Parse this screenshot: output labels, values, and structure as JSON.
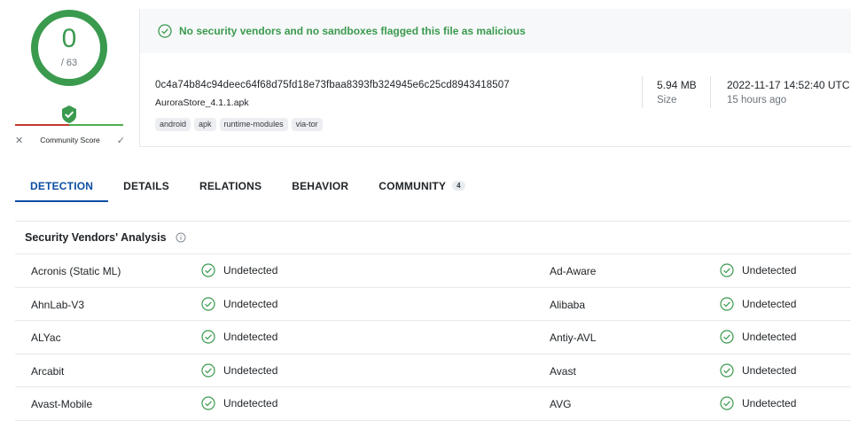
{
  "score": {
    "detections": "0",
    "total": "/ 63",
    "community_label": "Community Score",
    "ring_color": "#3a9a4e"
  },
  "summary": {
    "banner": "No security vendors and no sandboxes flagged this file as malicious",
    "hash": "0c4a74b84c94deec64f68d75fd18e73fbaa8393fb324945e6c25cd8943418507",
    "filename": "AuroraStore_4.1.1.apk",
    "tags": [
      "android",
      "apk",
      "runtime-modules",
      "via-tor"
    ],
    "size_value": "5.94 MB",
    "size_label": "Size",
    "date_value": "2022-11-17 14:52:40 UTC",
    "date_label": "15 hours ago"
  },
  "tabs": [
    {
      "label": "DETECTION",
      "active": true
    },
    {
      "label": "DETAILS"
    },
    {
      "label": "RELATIONS"
    },
    {
      "label": "BEHAVIOR"
    },
    {
      "label": "COMMUNITY",
      "badge": "4"
    }
  ],
  "vendors": {
    "title": "Security Vendors' Analysis",
    "rows": [
      {
        "left_name": "Acronis (Static ML)",
        "left_status": "Undetected",
        "right_name": "Ad-Aware",
        "right_status": "Undetected"
      },
      {
        "left_name": "AhnLab-V3",
        "left_status": "Undetected",
        "right_name": "Alibaba",
        "right_status": "Undetected"
      },
      {
        "left_name": "ALYac",
        "left_status": "Undetected",
        "right_name": "Antiy-AVL",
        "right_status": "Undetected"
      },
      {
        "left_name": "Arcabit",
        "left_status": "Undetected",
        "right_name": "Avast",
        "right_status": "Undetected"
      },
      {
        "left_name": "Avast-Mobile",
        "left_status": "Undetected",
        "right_name": "AVG",
        "right_status": "Undetected"
      }
    ]
  },
  "colors": {
    "clean_green": "#3a9a4e",
    "active_tab_blue": "#0b4ea2"
  }
}
